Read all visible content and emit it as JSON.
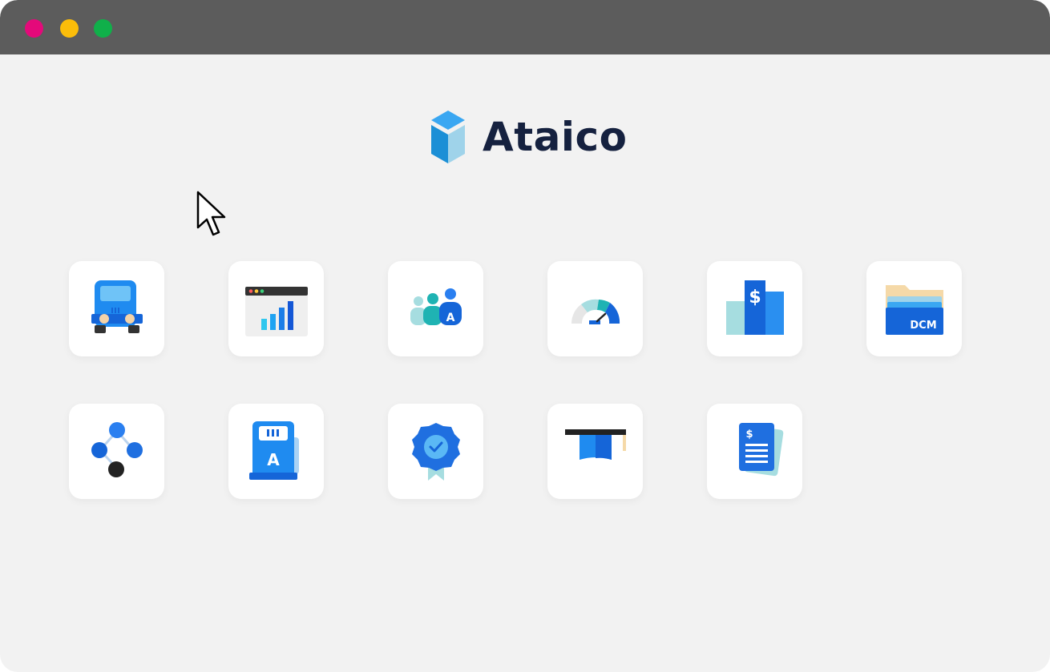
{
  "window": {
    "controls": [
      {
        "name": "close",
        "color": "#e4097a"
      },
      {
        "name": "minimize",
        "color": "#fbbd0a"
      },
      {
        "name": "maximize",
        "color": "#10b04a"
      }
    ],
    "background": "#f2f2f2",
    "titlebar_color": "#5c5c5c"
  },
  "brand": {
    "name": "Ataico",
    "logo_icon": "hexagon-cube-icon",
    "text_color": "#15213f"
  },
  "apps": [
    {
      "icon": "bus-icon",
      "row": 1,
      "col": 1
    },
    {
      "icon": "browser-bar-chart-icon",
      "row": 1,
      "col": 2
    },
    {
      "icon": "team-people-icon",
      "row": 1,
      "col": 3,
      "badge": "A"
    },
    {
      "icon": "speedometer-gauge-icon",
      "row": 1,
      "col": 4
    },
    {
      "icon": "dollar-bar-chart-icon",
      "row": 1,
      "col": 5,
      "badge": "$"
    },
    {
      "icon": "folder-dcm-icon",
      "row": 1,
      "col": 6,
      "badge": "DCM"
    },
    {
      "icon": "network-nodes-icon",
      "row": 2,
      "col": 1
    },
    {
      "icon": "card-terminal-icon",
      "row": 2,
      "col": 2,
      "badge": "A"
    },
    {
      "icon": "award-badge-icon",
      "row": 2,
      "col": 3
    },
    {
      "icon": "graduation-cap-icon",
      "row": 2,
      "col": 4
    },
    {
      "icon": "invoice-document-icon",
      "row": 2,
      "col": 5,
      "badge": "$"
    }
  ],
  "colors": {
    "primary_blue": "#1f6fe0",
    "light_blue": "#3aa7f2",
    "teal": "#1fb3b3",
    "pale_teal": "#a6dde0"
  }
}
